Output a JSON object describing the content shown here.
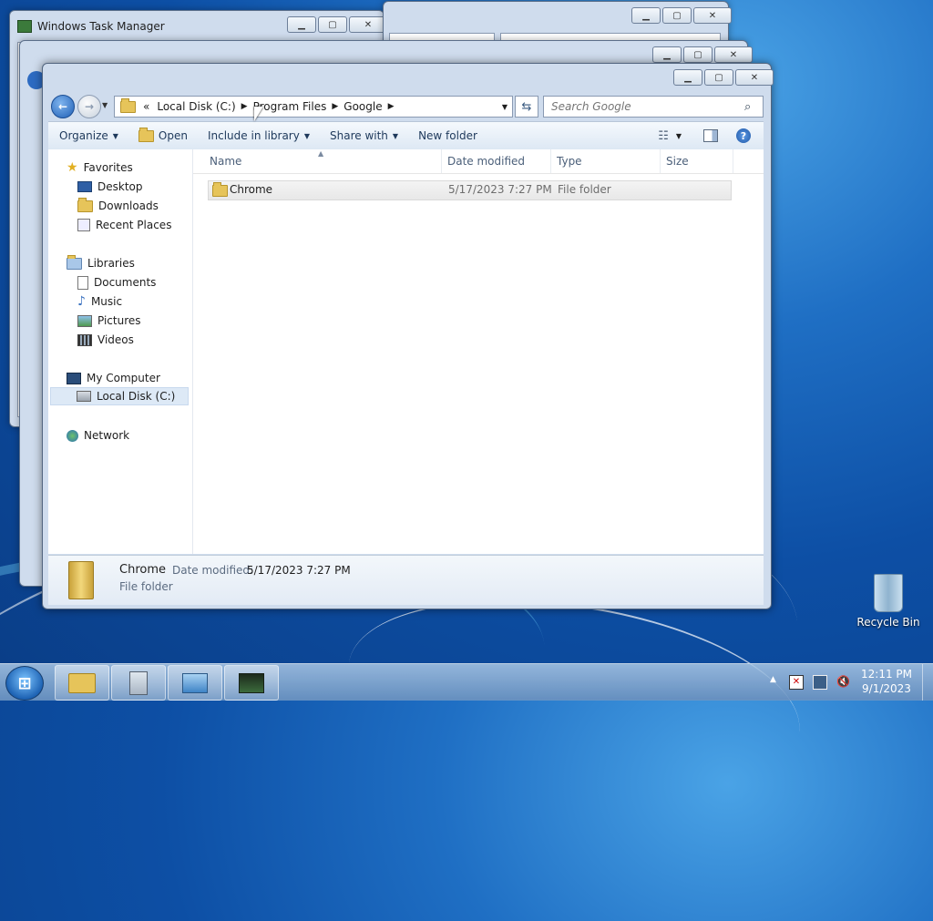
{
  "taskmgr": {
    "title": "Windows Task Manager"
  },
  "explorer": {
    "breadcrumb": {
      "overflow": "«",
      "items": [
        "Local Disk (C:)",
        "Program Files",
        "Google"
      ]
    },
    "search_placeholder": "Search Google",
    "toolbar": {
      "organize": "Organize",
      "open": "Open",
      "include": "Include in library",
      "share": "Share with",
      "newfolder": "New folder"
    },
    "nav": {
      "favorites": "Favorites",
      "desktop": "Desktop",
      "downloads": "Downloads",
      "recent": "Recent Places",
      "libraries": "Libraries",
      "documents": "Documents",
      "music": "Music",
      "pictures": "Pictures",
      "videos": "Videos",
      "computer": "My Computer",
      "localdisk": "Local Disk (C:)",
      "network": "Network"
    },
    "columns": {
      "name": "Name",
      "date": "Date modified",
      "type": "Type",
      "size": "Size"
    },
    "files": [
      {
        "name": "Chrome",
        "date": "5/17/2023 7:27 PM",
        "type": "File folder",
        "size": ""
      }
    ],
    "details": {
      "name": "Chrome",
      "date_label": "Date modified:",
      "date_value": "5/17/2023 7:27 PM",
      "type": "File folder"
    }
  },
  "desktop": {
    "recycle_bin": "Recycle Bin"
  },
  "tray": {
    "time": "12:11 PM",
    "date": "9/1/2023"
  },
  "colors": {
    "accent": "#1e395b",
    "selection": "#dde9f6"
  }
}
